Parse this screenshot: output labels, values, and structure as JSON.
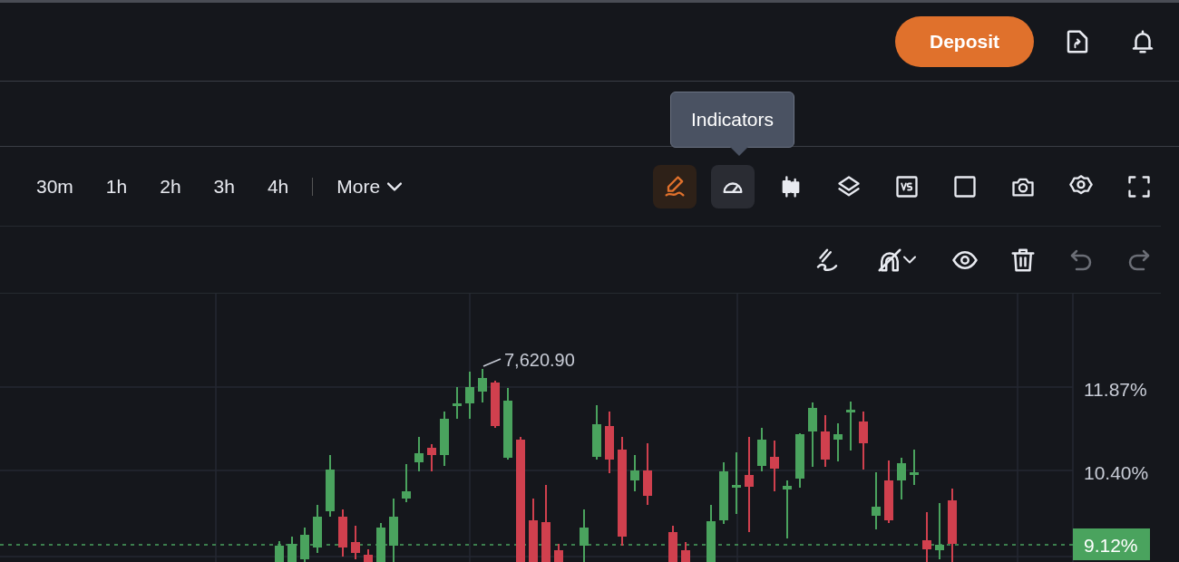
{
  "header": {
    "deposit_button": "Deposit"
  },
  "tooltip": {
    "text": "Indicators"
  },
  "time_frames": [
    {
      "label": "30m",
      "selected": false
    },
    {
      "label": "1h",
      "selected": false
    },
    {
      "label": "2h",
      "selected": false
    },
    {
      "label": "3h",
      "selected": false
    },
    {
      "label": "4h",
      "selected": false
    }
  ],
  "more_button": "More",
  "chart_tools": [
    {
      "kind": "draw",
      "active": true,
      "hovered": false
    },
    {
      "kind": "indicators",
      "active": false,
      "hovered": true
    },
    {
      "kind": "candles",
      "active": false,
      "hovered": false
    },
    {
      "kind": "layers",
      "active": false,
      "hovered": false
    },
    {
      "kind": "compare",
      "active": false,
      "hovered": false
    },
    {
      "kind": "square",
      "active": false,
      "hovered": false
    },
    {
      "kind": "camera",
      "active": false,
      "hovered": false
    },
    {
      "kind": "settings",
      "active": false,
      "hovered": false
    },
    {
      "kind": "fullscreen",
      "active": false,
      "hovered": false
    }
  ],
  "drawing_tools": [
    {
      "kind": "freehand",
      "disabled": false
    },
    {
      "kind": "magnet",
      "disabled": false
    },
    {
      "kind": "visibility",
      "disabled": false
    },
    {
      "kind": "delete",
      "disabled": false
    },
    {
      "kind": "undo",
      "disabled": true
    },
    {
      "kind": "redo",
      "disabled": true
    }
  ],
  "chart": {
    "high_label": "7,620.90",
    "y_axis_labels": [
      "11.87%",
      "10.40%"
    ],
    "last_value": "9.12%"
  }
}
